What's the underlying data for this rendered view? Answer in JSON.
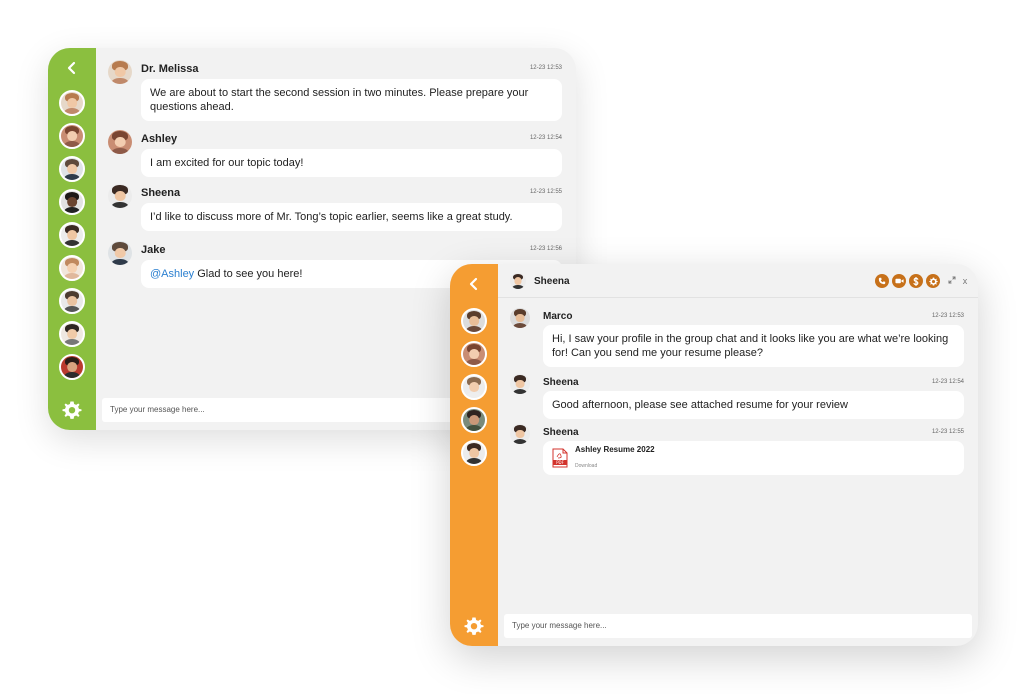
{
  "colors": {
    "green": "#8bbf3f",
    "orange": "#f59d32",
    "accent": "#c7711a",
    "mention": "#2a7fd0"
  },
  "icons": {
    "back": "chevron-left-icon",
    "settings": "gear-icon",
    "call": "phone-icon",
    "video": "video-camera-icon",
    "pay": "dollar-icon",
    "options": "gear-icon",
    "expand": "expand-icon",
    "close": "close-icon",
    "file": "pdf-icon"
  },
  "group_chat": {
    "messages": [
      {
        "name": "Dr. Melissa",
        "time": "12-23 12:53",
        "text": "We are about to start the second session in two minutes. Please prepare your questions ahead."
      },
      {
        "name": "Ashley",
        "time": "12-23 12:54",
        "text": "I am excited for our topic today!"
      },
      {
        "name": "Sheena",
        "time": "12-23 12:55",
        "text": "I’d like to discuss more of Mr. Tong’s topic earlier, seems like a great study."
      },
      {
        "name": "Jake",
        "time": "12-23 12:56",
        "mention": "@Ashley",
        "text": " Glad to see you here!"
      }
    ],
    "input_placeholder": "Type your message here..."
  },
  "direct_chat": {
    "header_name": "Sheena",
    "close_label": "x",
    "messages": [
      {
        "name": "Marco",
        "time": "12-23 12:53",
        "text": "Hi, I saw your profile in the group chat and it looks like you are what we’re looking for! Can you send me your resume please?"
      },
      {
        "name": "Sheena",
        "time": "12-23 12:54",
        "text": "Good afternoon, please see attached resume for your review"
      },
      {
        "name": "Sheena",
        "time": "12-23 12:55",
        "file_name": "Ashley Resume 2022",
        "file_action": "Download",
        "file_type": "PDF"
      }
    ],
    "input_placeholder": "Type your message here..."
  }
}
